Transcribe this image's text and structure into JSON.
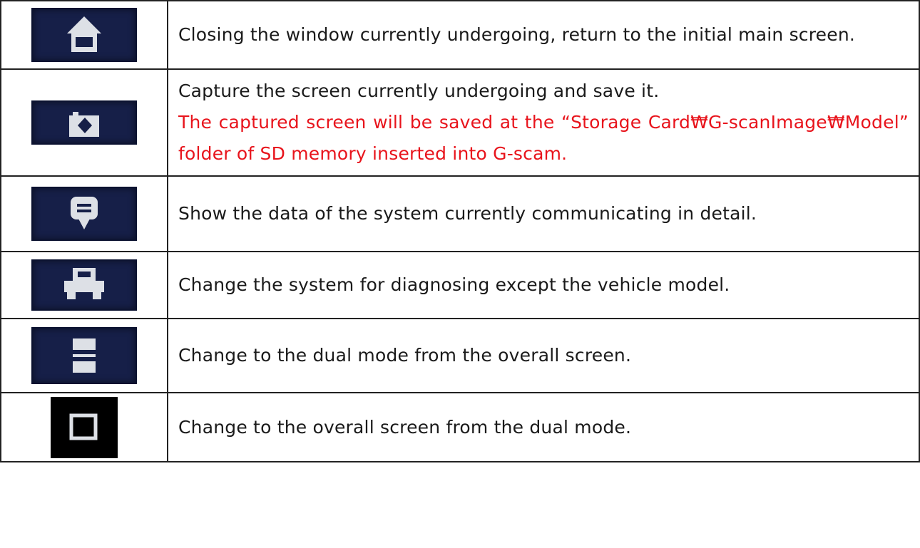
{
  "rows": [
    {
      "icon": "home-icon",
      "text": "Closing the window currently undergoing, return to the initial main screen."
    },
    {
      "icon": "camera-icon",
      "text": "Capture the screen currently undergoing and save it.",
      "note": "The captured screen will be saved at the “Storage Card₩G-scanImage₩Model” folder of SD memory inserted into G-scam."
    },
    {
      "icon": "speech-bubble-icon",
      "text": "Show the data of the system currently communicating in detail."
    },
    {
      "icon": "vehicle-icon",
      "text": "Change the system for diagnosing except the vehicle model."
    },
    {
      "icon": "dual-mode-icon",
      "text": "Change to the dual mode from the overall screen."
    },
    {
      "icon": "full-screen-icon",
      "text": "Change to the overall screen from the dual mode."
    }
  ],
  "colors": {
    "icon_background": "#161f48",
    "icon_glyph": "#dde0e6",
    "note_text": "#e8141c",
    "border": "#222222"
  }
}
